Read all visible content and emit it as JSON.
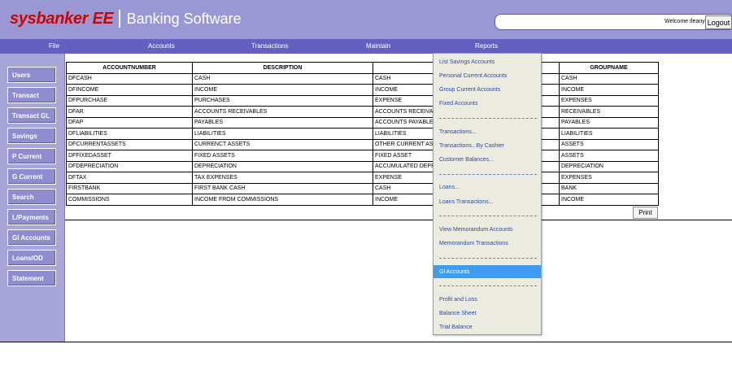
{
  "header": {
    "brand_name": "sysbanker EE",
    "brand_sub": "Banking Software",
    "welcome": "Welcome ifeanyi",
    "logout_label": "Logout"
  },
  "nav": {
    "items": [
      "File",
      "Accounts",
      "Transactions",
      "Maintain",
      "Reports"
    ]
  },
  "sidebar": {
    "items": [
      "Users",
      "Transact",
      "Transact GL",
      "Savings",
      "P Current",
      "G Current",
      "Search",
      "L/Payments",
      "Gl Accounts",
      "Loans/OD",
      "Statement"
    ]
  },
  "table": {
    "headers": [
      "ACCOUNTNUMBER",
      "DESCRIPTION",
      "",
      "GROUPNAME"
    ],
    "rows": [
      [
        "DFCASH",
        "CASH",
        "CASH",
        "CASH"
      ],
      [
        "DFINCOME",
        "INCOME",
        "INCOME",
        "INCOME"
      ],
      [
        "DFPURCHASE",
        "PURCHASES",
        "EXPENSE",
        "EXPENSES"
      ],
      [
        "DFAR",
        "ACCOUNTS RECEIVABLES",
        "ACCOUNTS RECEIVABLE",
        "RECEIVABLES"
      ],
      [
        "DFAP",
        "PAYABLES",
        "ACCOUNTS PAYABLE",
        "PAYABLES"
      ],
      [
        "DFLIABILITIES",
        "LIABILITIES",
        "LIABILITIES",
        "LIABILITIES"
      ],
      [
        "DFCURRENTASSETS",
        "CURRENCT ASSETS",
        "OTHER CURRENT ASSETS",
        "ASSETS"
      ],
      [
        "DFFIXEDASSET",
        "FIXED ASSETS",
        "FIXED ASSET",
        "ASSETS"
      ],
      [
        "DFDEPRECIATION",
        "DEPRECIATION",
        "ACCUMULATED DEPRECIATION",
        "DEPRECIATION"
      ],
      [
        "DFTAX",
        "TAX EXPENSES",
        "EXPENSE",
        "EXPENSES"
      ],
      [
        "FIRSTBANK",
        "FIRST BANK CASH",
        "CASH",
        "BANK"
      ],
      [
        "COMMISSIONS",
        "INCOME FROM COMMISSIONS",
        "INCOME",
        "INCOME"
      ]
    ],
    "print_label": "Print"
  },
  "reports_menu": {
    "items": [
      "List Savings Accounts",
      "Personal Current Accounts",
      "Group Current Accounts",
      "Fixed Accounts",
      "",
      "Transactions...",
      "Transactions...By Cashier",
      "Customer Balances...",
      "",
      "Loans...",
      "Loans Transactions...",
      "",
      "View Memorandum Accounts",
      "Memorandum Transactions",
      "",
      "Gl Accounts",
      "",
      "Profit and Loss",
      "Balance Sheet",
      "Trial Balance"
    ],
    "active_index": 15
  },
  "colors": {
    "header_bg": "#9a98d4",
    "nav_bg": "#6460c2",
    "brand_red": "#d40000",
    "menu_link": "#2f4aa0",
    "menu_highlight": "#3f9cf0"
  }
}
